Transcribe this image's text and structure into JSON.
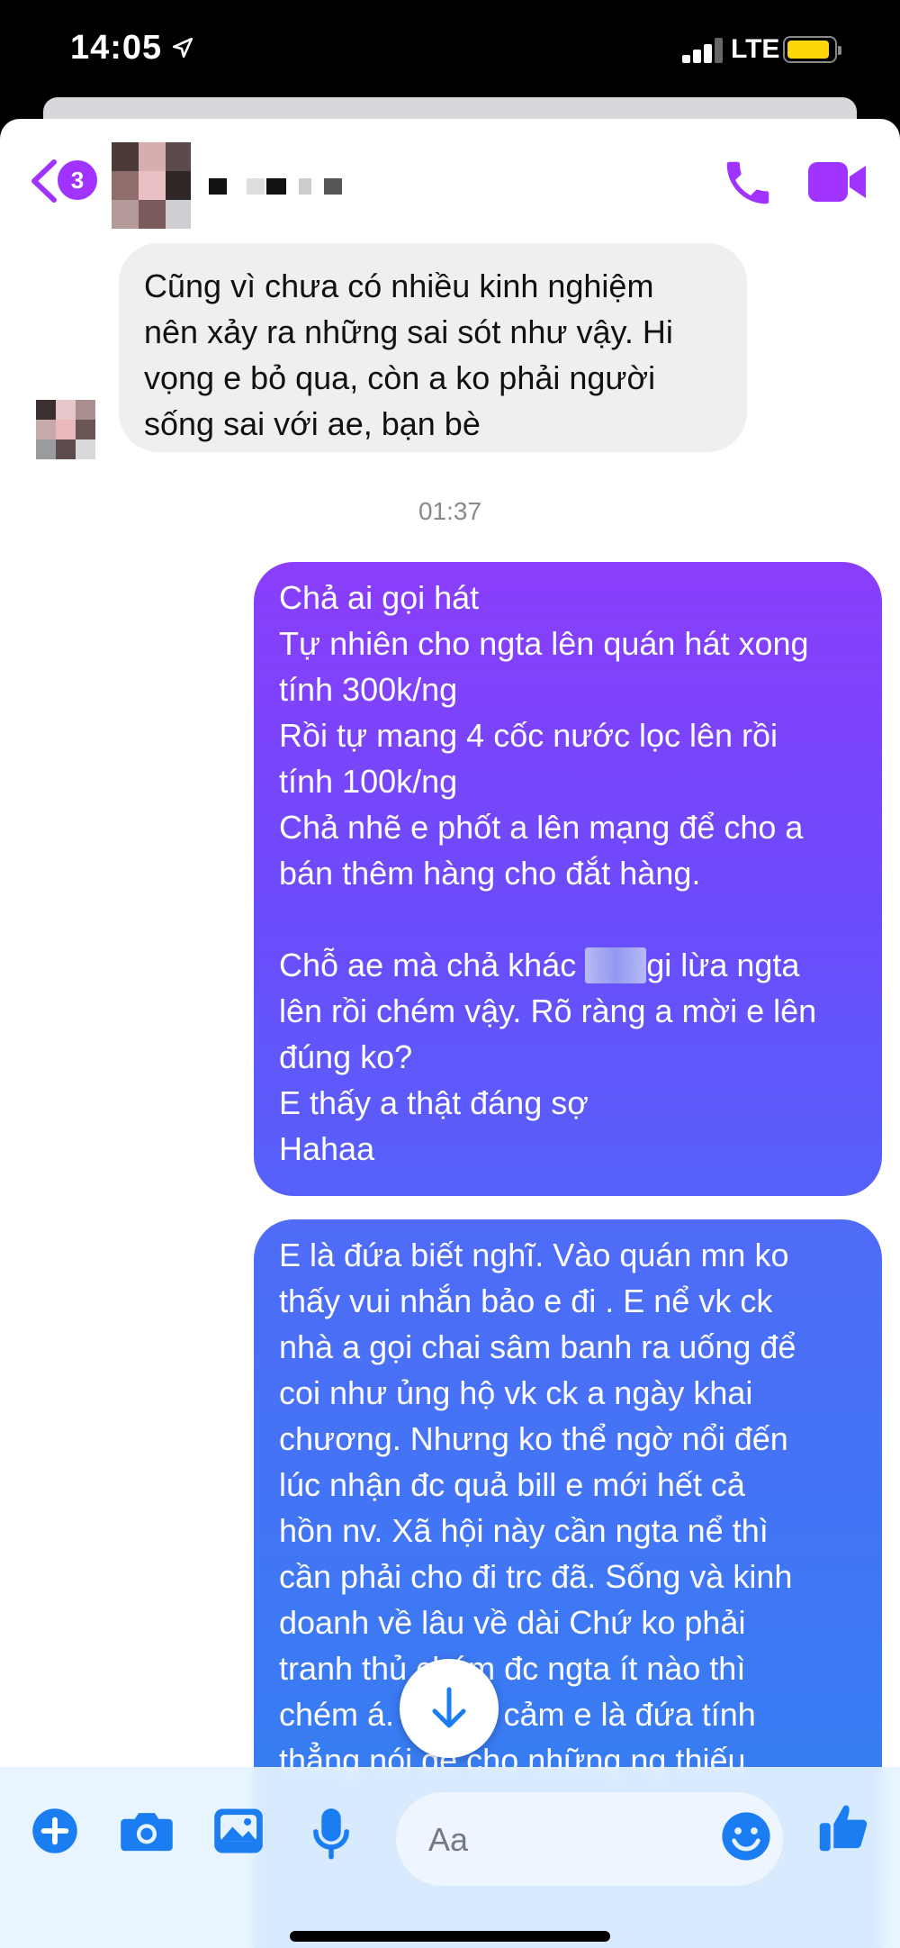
{
  "status_bar": {
    "time": "14:05",
    "network": "LTE",
    "battery_color": "#ffd60a"
  },
  "header": {
    "back_badge_count": "3",
    "accent_color": "#a033ff",
    "icons": [
      "chevron-left-icon",
      "phone-icon",
      "video-camera-icon"
    ]
  },
  "messages": {
    "incoming_1": "Cũng vì chưa có nhiều kinh nghiệm\nnên xảy ra những sai sót như vậy. Hi\nvọng e bỏ qua, còn a ko phải người\nsống sai với ae, bạn bè",
    "timestamp": "01:37",
    "outgoing_1a": "Chả ai gọi hát\nTự nhiên cho ngta lên quán hát xong\ntính 300k/ng\nRồi tự mang 4 cốc nước lọc lên rồi\ntính 100k/ng\nChả nhẽ e phốt a lên mạng để cho a\nbán thêm hàng cho đắt hàng.\n\nChỗ ae mà chả khác ",
    "outgoing_1b": "gi lừa ngta\nlên rồi chém vậy. Rõ ràng a mời e lên\nđúng ko?\nE thấy a thật đáng sợ\nHahaa",
    "outgoing_2": "E là đứa biết nghĩ. Vào quán mn ko\nthấy vui nhắn bảo e đi . E nể vk ck\nnhà a gọi chai sâm banh ra uống để\ncoi như ủng hộ vk ck a ngày khai\nchương. Nhưng ko thể ngờ nổi đến\nlúc nhận đc quả bill e mới hết cả\nhồn nv. Xã hội này cần ngta nể thì\ncần phải cho đi trc đã. Sống và kinh\ndoanh về lâu về dài Chứ ko phải\ntranh thủ chém đc ngta ít nào thì\nchém á. Thông cảm e là đứa tính\nthẳng nói để cho những ng thiếu"
  },
  "composer": {
    "placeholder": "Aa",
    "icons": [
      "plus-icon",
      "camera-icon",
      "image-icon",
      "microphone-icon",
      "emoji-icon",
      "thumbs-up-icon"
    ],
    "icon_color": "#1a7df2"
  }
}
